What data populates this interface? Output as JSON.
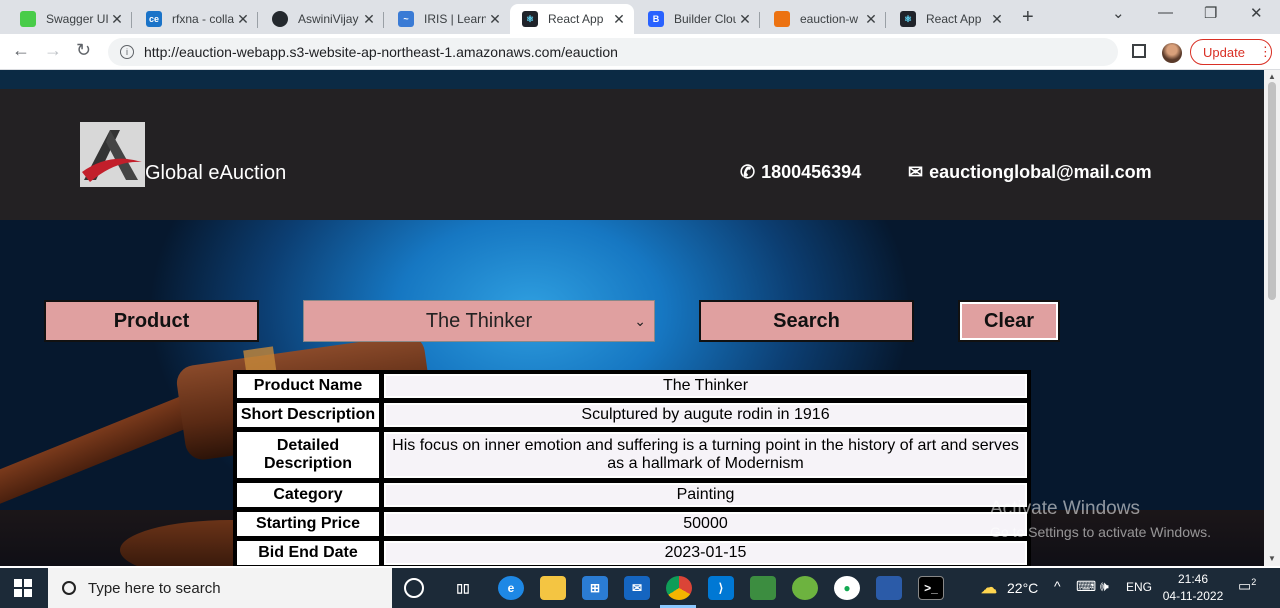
{
  "browser": {
    "tabs": [
      {
        "label": "Swagger UI",
        "favicon": "swagger-icon",
        "color": "#49cc49",
        "active": false
      },
      {
        "label": "rfxna - colla",
        "favicon": "ce-icon",
        "color": "#1a73c8",
        "active": false
      },
      {
        "label": "AswiniVijay",
        "favicon": "github-icon",
        "color": "#24292e",
        "active": false
      },
      {
        "label": "IRIS | Learn",
        "favicon": "iris-icon",
        "color": "#3a7bd5",
        "active": false
      },
      {
        "label": "React App",
        "favicon": "react-icon",
        "color": "#20232a",
        "active": true
      },
      {
        "label": "Builder Clou",
        "favicon": "builder-icon",
        "color": "#2962ff",
        "active": false
      },
      {
        "label": "eauction-w",
        "favicon": "aws-icon",
        "color": "#ec7211",
        "active": false
      },
      {
        "label": "React App",
        "favicon": "react-icon",
        "color": "#20232a",
        "active": false
      }
    ],
    "url": "http://eauction-webapp.s3-website-ap-northeast-1.amazonaws.com/eauction",
    "update_label": "Update"
  },
  "site": {
    "brand": "Global eAuction",
    "phone": "1800456394",
    "email": "eauctionglobal@mail.com"
  },
  "controls": {
    "product_label": "Product",
    "selected_product": "The Thinker",
    "search_label": "Search",
    "clear_label": "Clear"
  },
  "details": {
    "rows": [
      {
        "label": "Product Name",
        "value": "The Thinker"
      },
      {
        "label": "Short Description",
        "value": "Sculptured by augute rodin in 1916"
      },
      {
        "label": "Detailed Description",
        "value": "His focus on inner emotion and suffering is a turning point in the history of art and serves as a hallmark of Modernism"
      },
      {
        "label": "Category",
        "value": "Painting"
      },
      {
        "label": "Starting Price",
        "value": "50000"
      },
      {
        "label": "Bid End Date",
        "value": "2023-01-15"
      }
    ]
  },
  "watermark": {
    "line1": "Activate Windows",
    "line2": "Go to Settings to activate Windows."
  },
  "taskbar": {
    "search_placeholder": "Type here to search",
    "temperature": "22°C",
    "language": "ENG",
    "time": "21:46",
    "date": "04-11-2022",
    "notification_count": "2"
  }
}
